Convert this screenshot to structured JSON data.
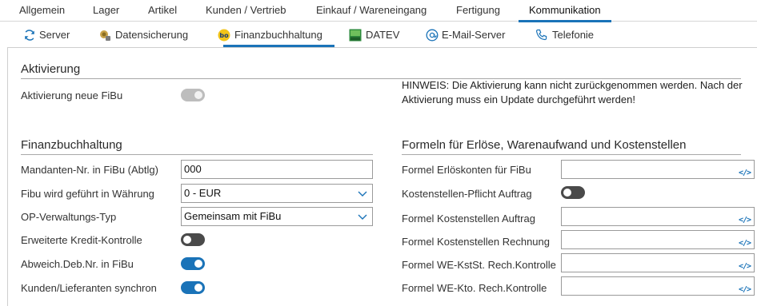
{
  "tabs": [
    {
      "label": "Allgemein"
    },
    {
      "label": "Lager"
    },
    {
      "label": "Artikel"
    },
    {
      "label": "Kunden / Vertrieb"
    },
    {
      "label": "Einkauf / Wareneingang"
    },
    {
      "label": "Fertigung"
    },
    {
      "label": "Kommunikation",
      "active": true
    }
  ],
  "subtabs": [
    {
      "label": "Server",
      "icon": "refresh-icon"
    },
    {
      "label": "Datensicherung",
      "icon": "backup-icon"
    },
    {
      "label": "Finanzbuchhaltung",
      "icon": "fibu-icon",
      "active": true
    },
    {
      "label": "DATEV",
      "icon": "datev-icon"
    },
    {
      "label": "E-Mail-Server",
      "icon": "at-icon"
    },
    {
      "label": "Telefonie",
      "icon": "phone-icon"
    }
  ],
  "aktivierung": {
    "title": "Aktivierung",
    "label": "Aktivierung neue FiBu",
    "toggle": "on-disabled",
    "hint": "HINWEIS: Die Aktivierung kann nicht zurückgenommen werden. Nach der Aktivierung muss ein Update durchgeführt werden!"
  },
  "fibu": {
    "title": "Finanzbuchhaltung",
    "mandant_label": "Mandanten-Nr. in FiBu (Abtlg)",
    "mandant_value": "000",
    "waehrung_label": "Fibu wird geführt in Währung",
    "waehrung_value": "0 - EUR",
    "op_label": "OP-Verwaltungs-Typ",
    "op_value": "Gemeinsam mit FiBu",
    "kredit_label": "Erweiterte Kredit-Kontrolle",
    "kredit_toggle": "off",
    "abweich_label": "Abweich.Deb.Nr. in FiBu",
    "abweich_toggle": "on",
    "sync_label": "Kunden/Lieferanten synchron",
    "sync_toggle": "on"
  },
  "formeln": {
    "title": "Formeln für Erlöse, Warenaufwand und Kostenstellen",
    "erloes_label": "Formel Erlöskonten für FiBu",
    "ks_pflicht_label": "Kostenstellen-Pflicht Auftrag",
    "ks_pflicht_toggle": "off",
    "ks_auftrag_label": "Formel Kostenstellen Auftrag",
    "ks_rechnung_label": "Formel Kostenstellen Rechnung",
    "we_kst_label": "Formel WE-KstSt. Rech.Kontrolle",
    "we_kto_label": "Formel WE-Kto. Rech.Kontrolle",
    "code_glyph": "</>"
  },
  "colors": {
    "accent": "#1a73b8",
    "toggle_off": "#4a4a4a",
    "toggle_disabled": "#bdbdbd"
  }
}
